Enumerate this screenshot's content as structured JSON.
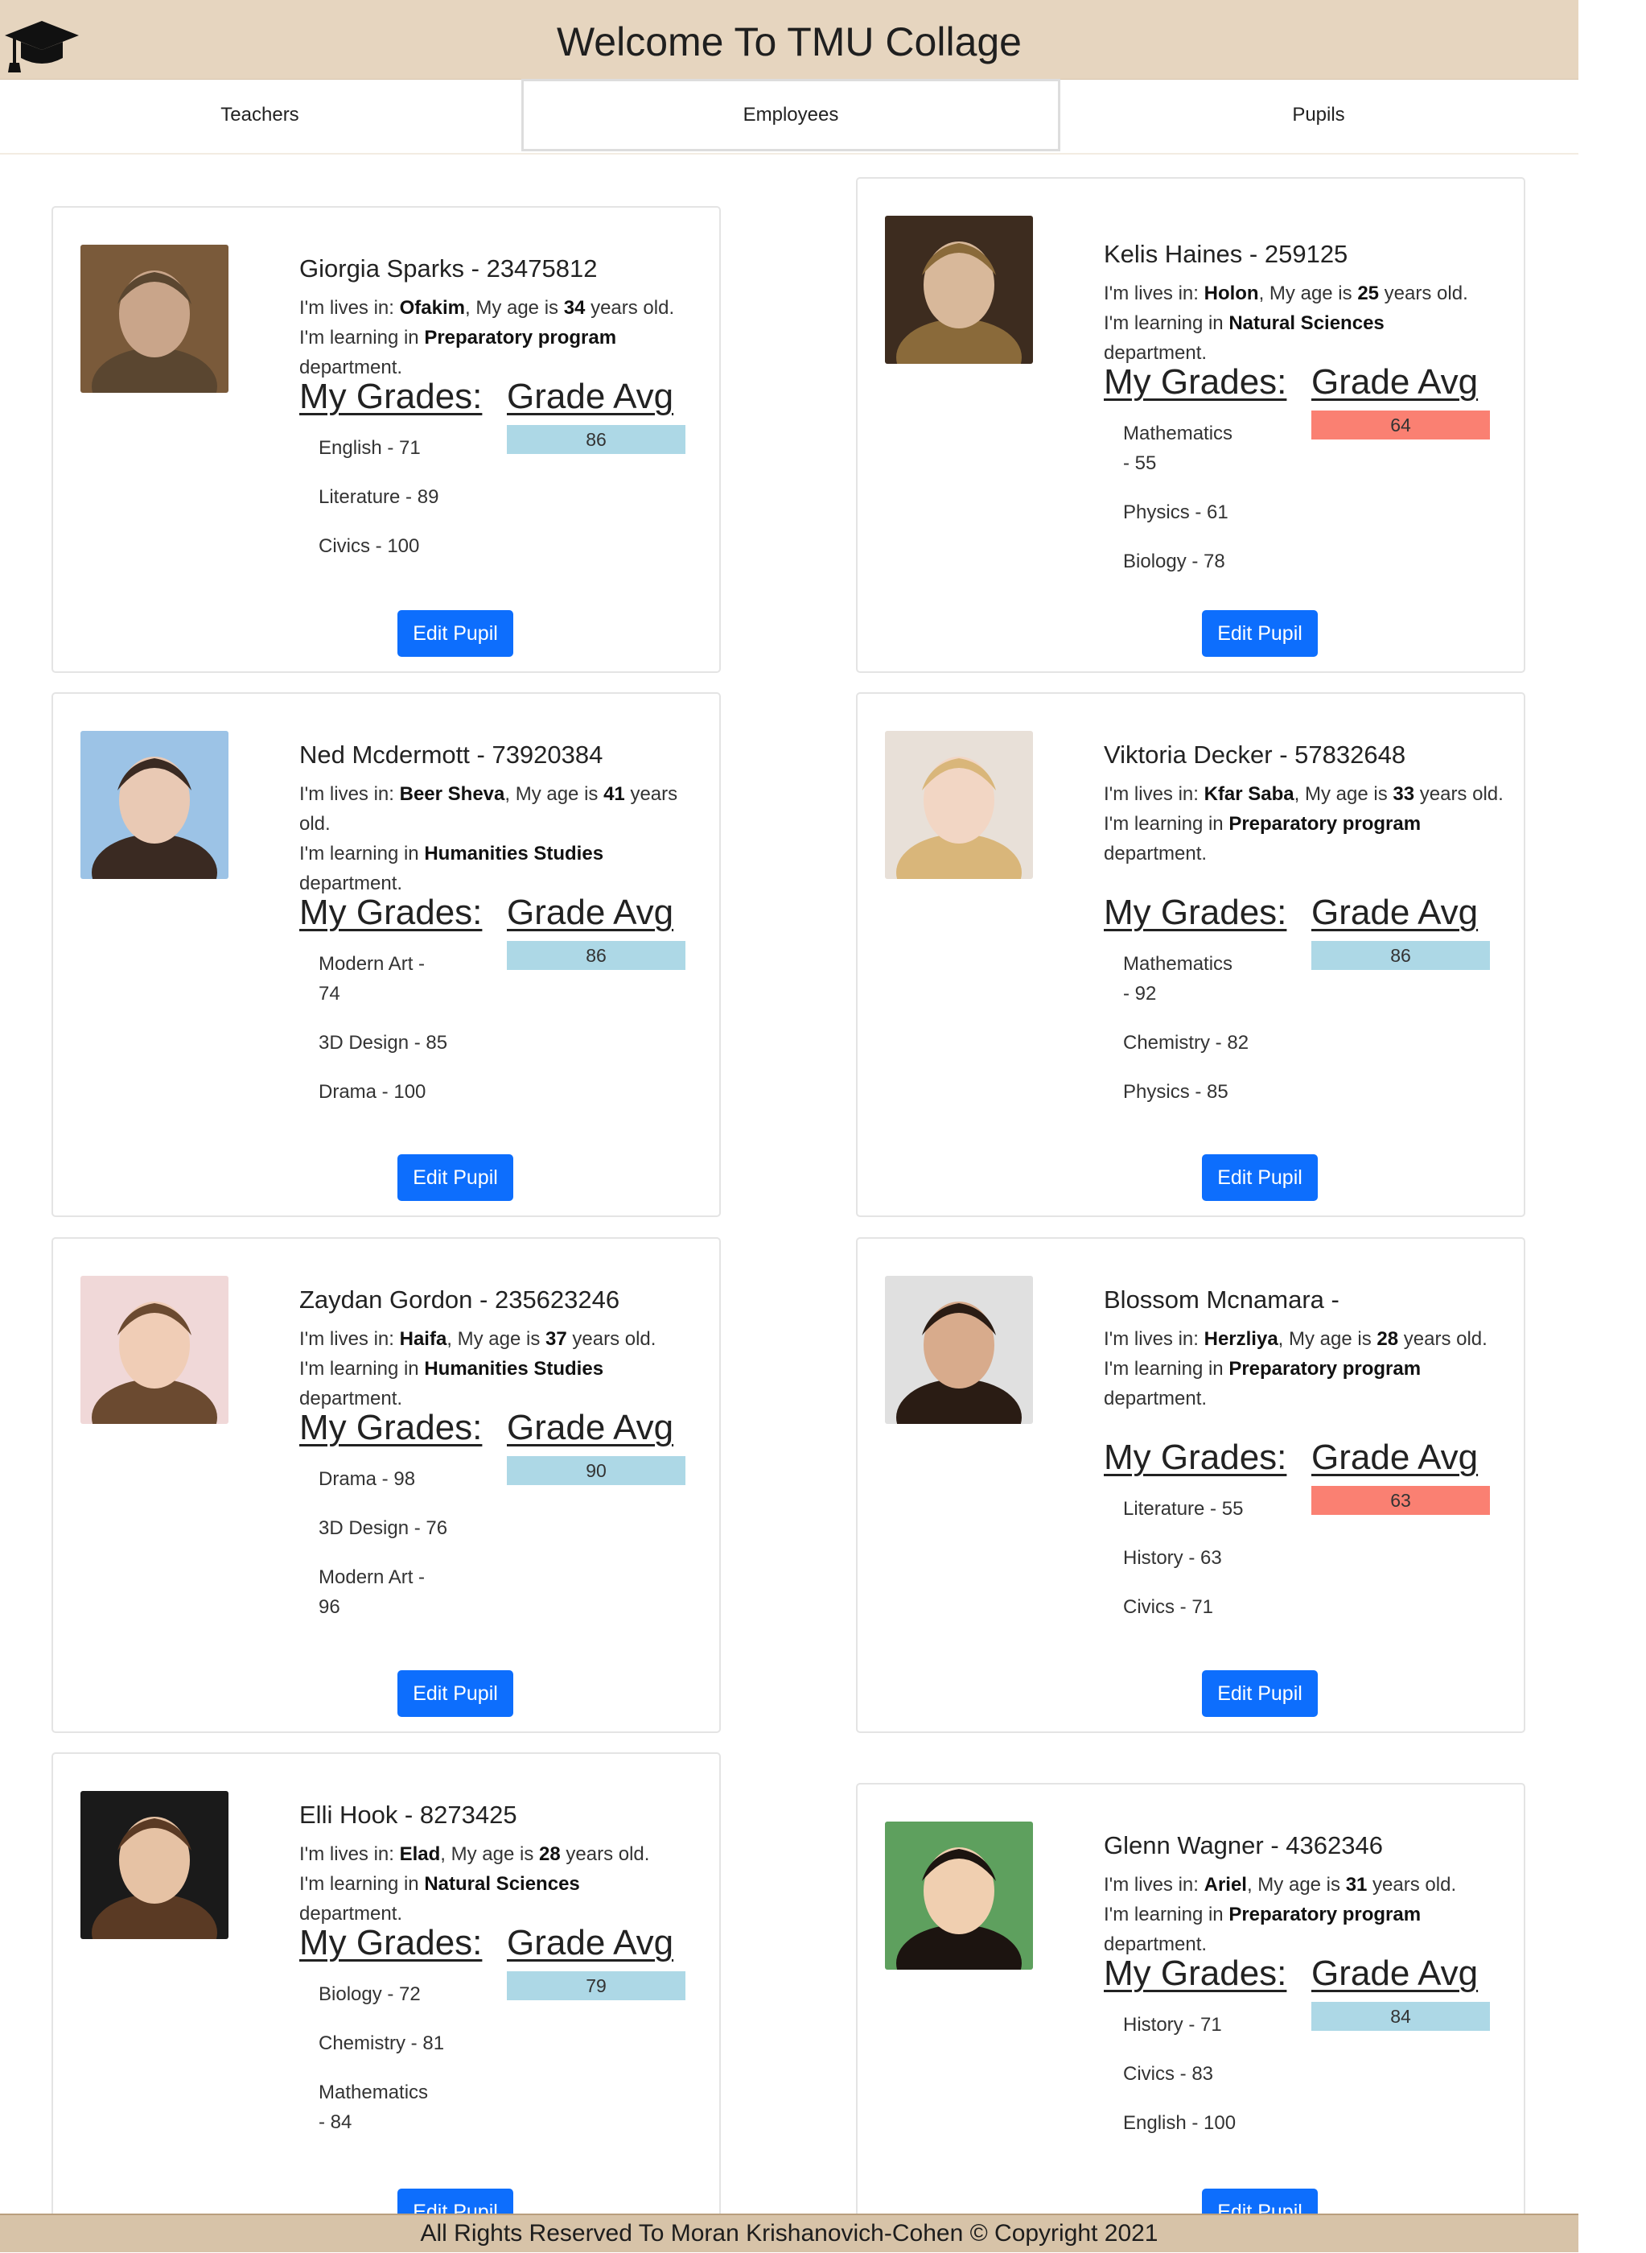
{
  "header": {
    "title": "Welcome To TMU Collage",
    "logo_icon": "graduation-cap-icon"
  },
  "tabs": [
    {
      "label": "Teachers"
    },
    {
      "label": "Employees"
    },
    {
      "label": "Pupils"
    }
  ],
  "labels": {
    "lives_prefix": "I'm lives in: ",
    "age_mid": ", My age is ",
    "age_suffix": " years old.",
    "learning_prefix": "I'm learning in ",
    "learning_suffix": " department.",
    "my_grades": "My Grades:",
    "grade_avg": "Grade Avg",
    "edit_button": "Edit Pupil"
  },
  "colors": {
    "avg_good": "#add8e6",
    "avg_low": "#fa8072",
    "button": "#0d6efd",
    "header_bg": "#e6d5bf"
  },
  "pupils": [
    {
      "name": "Giorgia Sparks - 23475812",
      "city": "Ofakim",
      "age": "34",
      "department": "Preparatory program",
      "grades": [
        "English - 71",
        "Literature - 89",
        "Civics - 100"
      ],
      "avg": "86",
      "avg_status": "good"
    },
    {
      "name": "Kelis Haines - 259125",
      "city": "Holon",
      "age": "25",
      "department": "Natural Sciences",
      "grades": [
        "Mathematics - 55",
        "Physics - 61",
        "Biology - 78"
      ],
      "avg": "64",
      "avg_status": "low"
    },
    {
      "name": "Ned Mcdermott - 73920384",
      "city": "Beer Sheva",
      "age": "41",
      "department": "Humanities Studies",
      "grades": [
        "Modern Art - 74",
        "3D Design - 85",
        "Drama - 100"
      ],
      "avg": "86",
      "avg_status": "good"
    },
    {
      "name": "Viktoria Decker - 57832648",
      "city": "Kfar Saba",
      "age": "33",
      "department": "Preparatory program",
      "grades": [
        "Mathematics - 92",
        "Chemistry - 82",
        "Physics - 85"
      ],
      "avg": "86",
      "avg_status": "good"
    },
    {
      "name": "Zaydan Gordon - 235623246",
      "city": "Haifa",
      "age": "37",
      "department": "Humanities Studies",
      "grades": [
        "Drama - 98",
        "3D Design - 76",
        "Modern Art - 96"
      ],
      "avg": "90",
      "avg_status": "good"
    },
    {
      "name": "Blossom Mcnamara -",
      "city": "Herzliya",
      "age": "28",
      "department": "Preparatory program",
      "grades": [
        "Literature - 55",
        "History - 63",
        "Civics - 71"
      ],
      "avg": "63",
      "avg_status": "low"
    },
    {
      "name": "Elli Hook - 8273425",
      "city": "Elad",
      "age": "28",
      "department": "Natural Sciences",
      "grades": [
        "Biology - 72",
        "Chemistry - 81",
        "Mathematics - 84"
      ],
      "avg": "79",
      "avg_status": "good"
    },
    {
      "name": "Glenn Wagner - 4362346",
      "city": "Ariel",
      "age": "31",
      "department": "Preparatory program",
      "grades": [
        "History - 71",
        "Civics - 83",
        "English - 100"
      ],
      "avg": "84",
      "avg_status": "good"
    }
  ],
  "footer": {
    "text": "All Rights Reserved To Moran Krishanovich-Cohen © Copyright 2021"
  }
}
